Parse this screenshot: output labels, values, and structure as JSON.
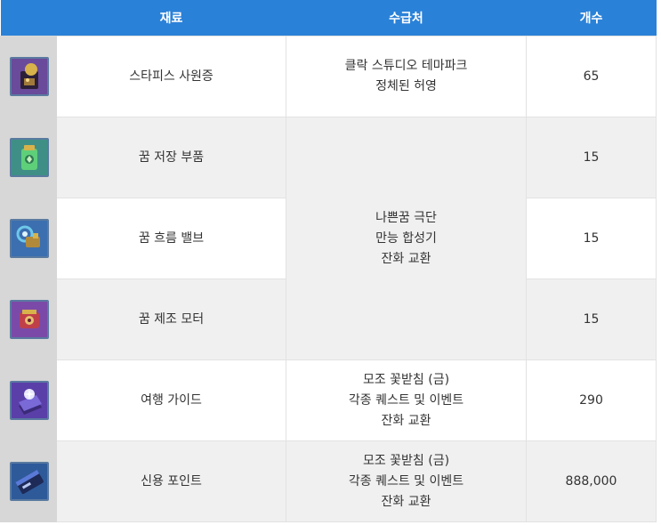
{
  "header": {
    "col_material": "재료",
    "col_source": "수급처",
    "col_count": "개수"
  },
  "rows": [
    {
      "icon": "stapis-badge-icon",
      "icon_bg": "#6a4a9a",
      "name": "스타피스 사원증",
      "count": "65"
    },
    {
      "icon": "dream-storage-part-icon",
      "icon_bg": "#3f8f86",
      "name": "꿈 저장 부품",
      "count": "15"
    },
    {
      "icon": "dream-flow-valve-icon",
      "icon_bg": "#3b6fb0",
      "name": "꿈 흐름 밸브",
      "count": "15"
    },
    {
      "icon": "dream-motor-icon",
      "icon_bg": "#7b4aa8",
      "name": "꿈 제조 모터",
      "count": "15"
    },
    {
      "icon": "travel-guide-icon",
      "icon_bg": "#5a3fa8",
      "name": "여행 가이드",
      "count": "290"
    },
    {
      "icon": "credit-point-icon",
      "icon_bg": "#2e5a9a",
      "name": "신용 포인트",
      "count": "888,000"
    }
  ],
  "sources": {
    "s1": [
      "클락 스튜디오 테마파크",
      "정체된 허영"
    ],
    "s2": [
      "나쁜꿈 극단",
      "만능 합성기",
      "잔화 교환"
    ],
    "s3": [
      "모조 꽃받침 (금)",
      "각종 퀘스트 및 이벤트",
      "잔화 교환"
    ],
    "s4": [
      "모조 꽃받침 (금)",
      "각종 퀘스트 및 이벤트",
      "잔화 교환"
    ]
  }
}
